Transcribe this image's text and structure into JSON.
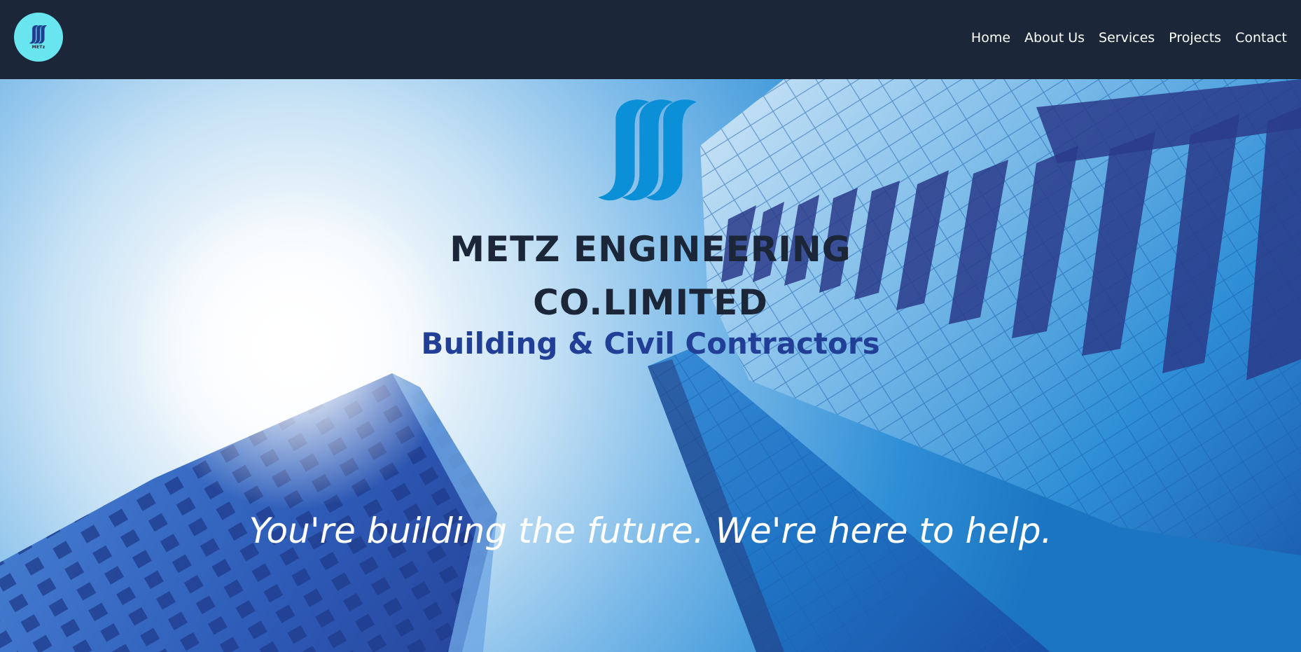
{
  "header": {
    "logo_text": "METz",
    "logo_icon": "metz-wave-logo-icon",
    "nav": [
      {
        "label": "Home"
      },
      {
        "label": "About Us"
      },
      {
        "label": "Services"
      },
      {
        "label": "Projects"
      },
      {
        "label": "Contact"
      }
    ]
  },
  "hero": {
    "logo_icon": "metz-wave-logo-icon",
    "title_line1": "METZ ENGINEERING",
    "title_line2": "CO.LIMITED",
    "subtitle": "Building & Civil Contractors",
    "tagline": "You're building the future. We're here to help.",
    "background": "skyscrapers-sky-photo"
  },
  "colors": {
    "navbar": "#1b2638",
    "logo_circle": "#69e5f0",
    "logo_wave": "#0b8fd6",
    "title": "#1b2638",
    "subtitle": "#213f96",
    "tagline": "#ffffff"
  }
}
